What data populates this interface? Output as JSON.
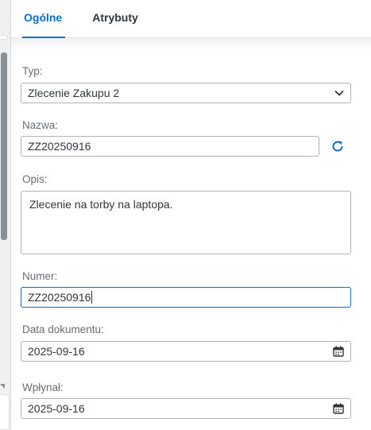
{
  "tabs": [
    {
      "label": "Ogólne",
      "active": true
    },
    {
      "label": "Atrybuty",
      "active": false
    }
  ],
  "fields": {
    "typ": {
      "label": "Typ:",
      "value": "Zlecenie Zakupu 2"
    },
    "nazwa": {
      "label": "Nazwa:",
      "value": "ZZ20250916"
    },
    "opis": {
      "label": "Opis:",
      "value": "Zlecenie na torby na laptopa."
    },
    "numer": {
      "label": "Numer:",
      "value": "ZZ20250916"
    },
    "data_dokumentu": {
      "label": "Data dokumentu:",
      "value": "2025-09-16"
    },
    "wplynal": {
      "label": "Wpłynał:",
      "value": "2025-09-16"
    }
  },
  "icons": {
    "select": "chevron-down-icon",
    "refresh": "refresh-icon",
    "date": "calendar-icon"
  },
  "colors": {
    "accent": "#0a6ed1",
    "label": "#6a6d70",
    "text": "#32363a",
    "border": "#b0b4b8"
  }
}
